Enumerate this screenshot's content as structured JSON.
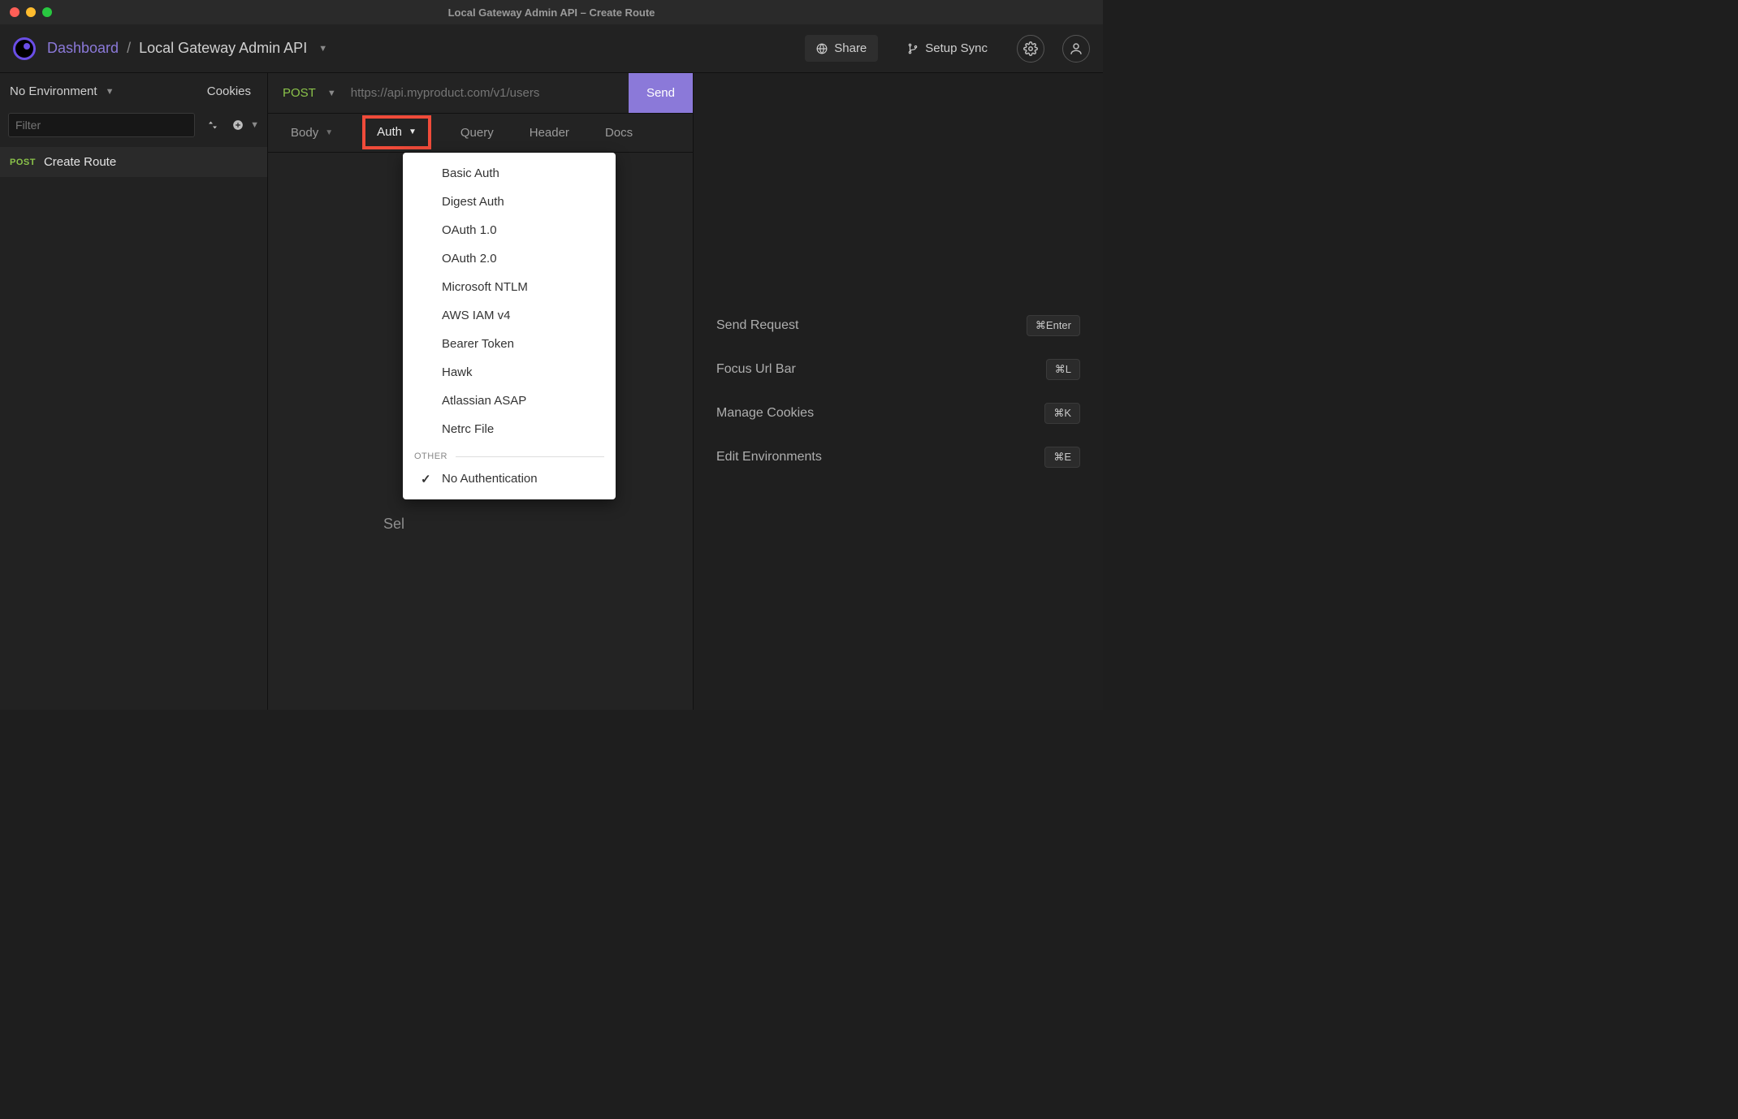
{
  "window": {
    "title": "Local Gateway Admin API – Create Route"
  },
  "breadcrumb": {
    "dashboard": "Dashboard",
    "sep": "/",
    "project": "Local Gateway Admin API"
  },
  "header": {
    "share": "Share",
    "setup_sync": "Setup Sync"
  },
  "sidebar": {
    "env_label": "No Environment",
    "cookies_label": "Cookies",
    "filter_placeholder": "Filter",
    "requests": [
      {
        "method": "POST",
        "name": "Create Route"
      }
    ]
  },
  "request": {
    "method": "POST",
    "url_placeholder": "https://api.myproduct.com/v1/users",
    "send_label": "Send",
    "tabs": {
      "body": "Body",
      "auth": "Auth",
      "query": "Query",
      "header": "Header",
      "docs": "Docs"
    },
    "empty_prefix": "Sel"
  },
  "auth_menu": {
    "items": [
      "Basic Auth",
      "Digest Auth",
      "OAuth 1.0",
      "OAuth 2.0",
      "Microsoft NTLM",
      "AWS IAM v4",
      "Bearer Token",
      "Hawk",
      "Atlassian ASAP",
      "Netrc File"
    ],
    "other_label": "OTHER",
    "no_auth": "No Authentication"
  },
  "response": {
    "shortcuts": [
      {
        "label": "Send Request",
        "key": "⌘Enter"
      },
      {
        "label": "Focus Url Bar",
        "key": "⌘L"
      },
      {
        "label": "Manage Cookies",
        "key": "⌘K"
      },
      {
        "label": "Edit Environments",
        "key": "⌘E"
      }
    ]
  }
}
